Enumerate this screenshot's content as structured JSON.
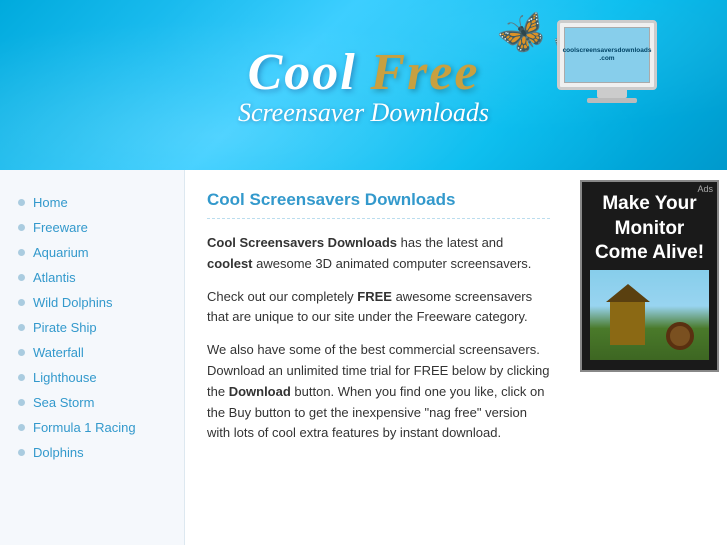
{
  "header": {
    "title_cool": "Cool",
    "title_free": "Free",
    "subtitle": "Screensaver Downloads",
    "monitor_text": "coolscreensaversdownloads\n.com"
  },
  "sidebar": {
    "items": [
      {
        "label": "Home"
      },
      {
        "label": "Freeware"
      },
      {
        "label": "Aquarium"
      },
      {
        "label": "Atlantis"
      },
      {
        "label": "Wild Dolphins"
      },
      {
        "label": "Pirate Ship"
      },
      {
        "label": "Waterfall"
      },
      {
        "label": "Lighthouse"
      },
      {
        "label": "Sea Storm"
      },
      {
        "label": "Formula 1 Racing"
      },
      {
        "label": "Dolphins"
      }
    ]
  },
  "content": {
    "title": "Cool Screensavers Downloads",
    "paragraph1_plain": " has the latest and ",
    "paragraph1_bold1": "Cool Screensavers Downloads",
    "paragraph1_bold2": "coolest",
    "paragraph1_end": " awesome 3D animated computer screensavers.",
    "paragraph2_bold": "FREE",
    "paragraph2_before": "Check out our completely ",
    "paragraph2_after": " awesome screensavers that are unique to our site under the Freeware category.",
    "paragraph3_download_bold": "Download",
    "paragraph3": "We also have some of the best commercial screensavers. Download an unlimited time trial for FREE below by clicking the ",
    "paragraph3_end": " button. When you find one you like, click on the Buy button to get the inexpensive \"nag free\" version with lots of cool extra features by instant download."
  },
  "ad": {
    "title": "Make Your Monitor Come Alive!",
    "label": "Ads"
  }
}
